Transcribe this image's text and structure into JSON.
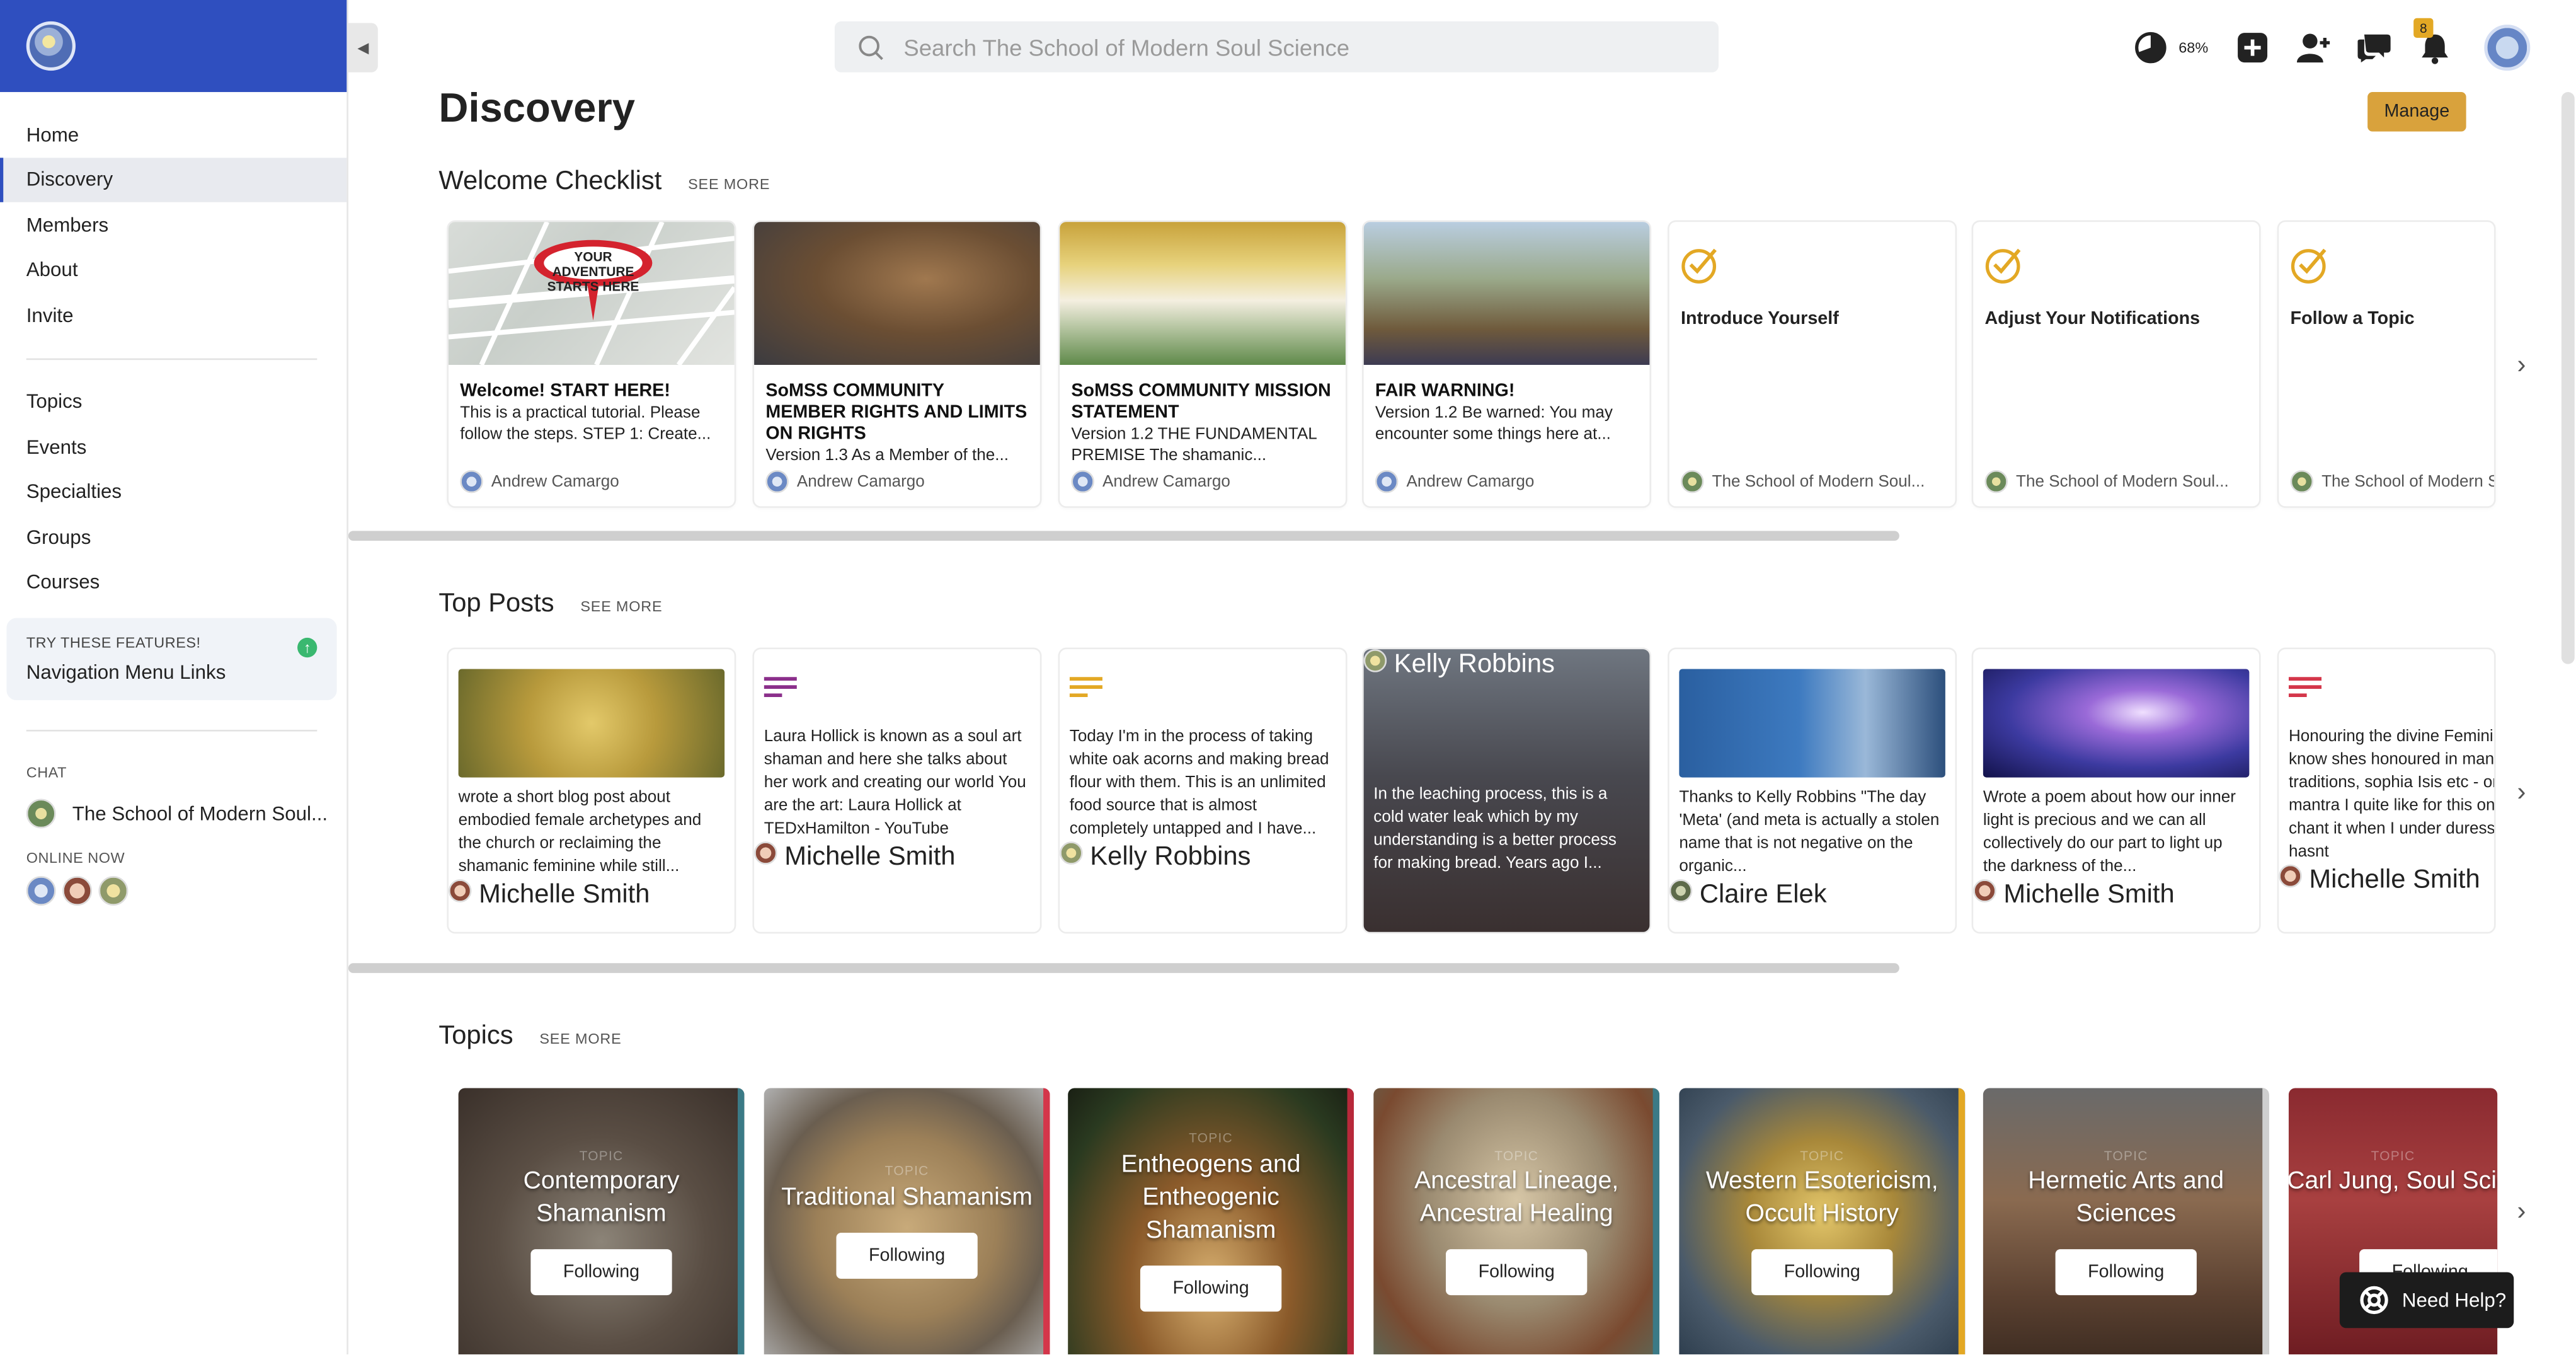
{
  "sidebar": {
    "nav_primary": [
      "Home",
      "Discovery",
      "Members",
      "About",
      "Invite"
    ],
    "nav_secondary": [
      "Topics",
      "Events",
      "Specialties",
      "Groups",
      "Courses"
    ],
    "try_features": {
      "title": "TRY THESE FEATURES!",
      "link": "Navigation Menu Links"
    },
    "chat_label": "CHAT",
    "chat_item": "The School of Modern Soul...",
    "online_label": "ONLINE NOW"
  },
  "topbar": {
    "search_placeholder": "Search The School of Modern Soul Science",
    "progress_pct": "68%",
    "notification_count": "8"
  },
  "page": {
    "title": "Discovery",
    "manage_label": "Manage"
  },
  "checklist": {
    "title": "Welcome Checklist",
    "see_more": "SEE MORE",
    "items": [
      {
        "title": "Welcome! START HERE!",
        "text": "This is a practical tutorial. Please follow the steps.  STEP 1: Create...",
        "author": "Andrew Camargo"
      },
      {
        "title": "SoMSS COMMUNITY MEMBER RIGHTS AND LIMITS ON RIGHTS",
        "text": "Version 1.3 As a Member of the...",
        "author": "Andrew Camargo"
      },
      {
        "title": "SoMSS COMMUNITY MISSION STATEMENT",
        "text": "Version 1.2 THE FUNDAMENTAL PREMISE The shamanic...",
        "author": "Andrew Camargo"
      },
      {
        "title": "FAIR WARNING!",
        "text": "Version 1.2 Be warned: You may encounter some things here at...",
        "author": "Andrew Camargo"
      },
      {
        "title": "Introduce Yourself",
        "author": "The School of Modern Soul..."
      },
      {
        "title": "Adjust Your Notifications",
        "author": "The School of Modern Soul..."
      },
      {
        "title": "Follow a Topic",
        "author": "The School of Modern Soul..."
      }
    ],
    "img_banner": "YOUR ADVENTURE STARTS HERE"
  },
  "posts": {
    "title": "Top Posts",
    "see_more": "SEE MORE",
    "items": [
      {
        "text": "wrote a short blog post about embodied female archetypes and the church or reclaiming the shamanic feminine while still...",
        "author": "Michelle Smith"
      },
      {
        "text": "Laura Hollick is known as a soul art shaman and here she talks about her work and creating our world  You are the art: Laura Hollick at TEDxHamilton - YouTube",
        "author": "Michelle Smith"
      },
      {
        "text": "Today I'm in the process of taking white oak acorns and making bread flour with them. This is an unlimited food source that is almost completely untapped and I have...",
        "author": "Kelly Robbins"
      },
      {
        "text": "In the leaching process, this is a cold water leak which by my understanding is a better process for making bread. Years ago I...",
        "author": "Kelly Robbins"
      },
      {
        "text": "Thanks to Kelly Robbins  \"The day 'Meta' (and meta is actually a stolen name that is not negative on the organic...",
        "author": "Claire Elek"
      },
      {
        "text": "Wrote a poem about how our inner light is precious and we can all collectively do our part to light up the darkness of the...",
        "author": "Michelle Smith"
      },
      {
        "text": "Honouring the divine Feminine I know shes honoured in many traditions, sophia Isis etc - one mantra I quite like for this one - I chant it when I under duress (which hasnt",
        "author": "Michelle Smith"
      }
    ]
  },
  "topics": {
    "title": "Topics",
    "see_more": "SEE MORE",
    "label": "TOPIC",
    "following": "Following",
    "items": [
      "Contemporary Shamanism",
      "Traditional Shamanism",
      "Entheogens and Entheogenic Shamanism",
      "Ancestral Lineage, Ancestral Healing",
      "Western Esotericism, Occult History",
      "Hermetic Arts and Sciences",
      "Carl Jung, Soul Science"
    ]
  },
  "help": {
    "label": "Need Help?"
  },
  "colors": {
    "brand": "#2f4fbf",
    "accent": "#d9a23c",
    "check": "#e3a824"
  }
}
